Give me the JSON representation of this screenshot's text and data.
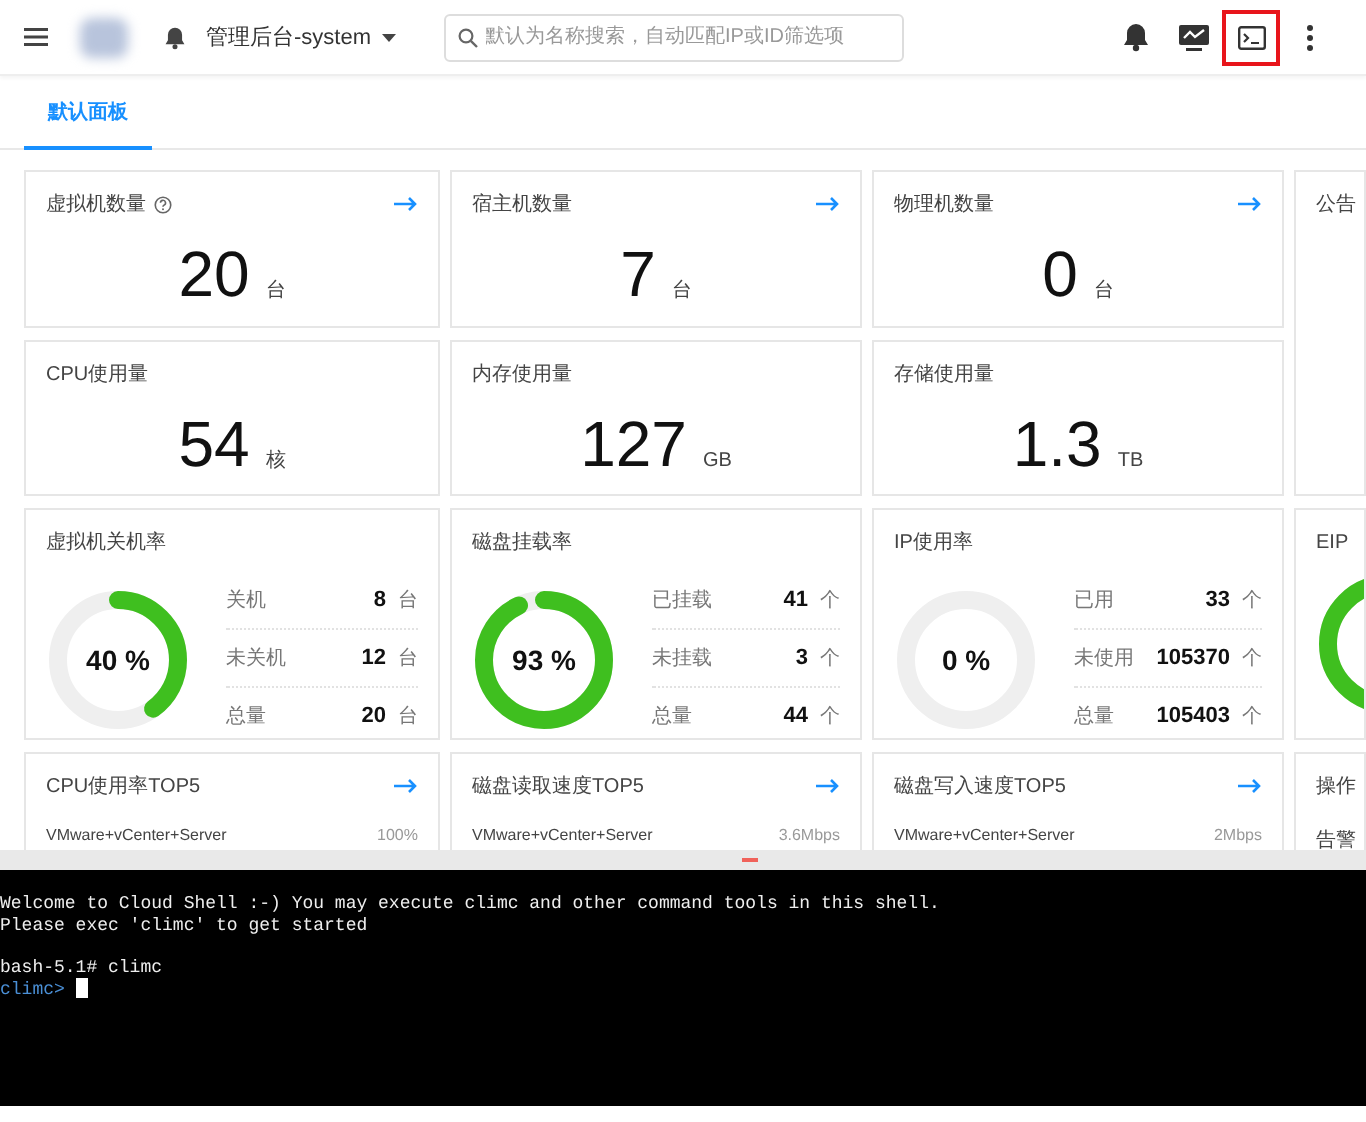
{
  "topbar": {
    "project": "管理后台-system",
    "search": {
      "placeholder": "默认为名称搜索，自动匹配IP或ID筛选项"
    },
    "actions": [
      {
        "kind": "bell",
        "highlighted": false
      },
      {
        "kind": "monitor",
        "highlighted": false
      },
      {
        "kind": "terminal",
        "highlighted": true
      },
      {
        "kind": "more",
        "highlighted": false
      }
    ]
  },
  "tabs": [
    {
      "label": "默认面板",
      "selected": true
    }
  ],
  "cards": [
    {
      "kind": "stat",
      "title": "虚拟机数量",
      "help": true,
      "link": true,
      "value": "20",
      "unit": "台"
    },
    {
      "kind": "stat",
      "title": "宿主机数量",
      "help": false,
      "link": true,
      "value": "7",
      "unit": "台"
    },
    {
      "kind": "stat",
      "title": "物理机数量",
      "help": false,
      "link": true,
      "value": "0",
      "unit": "台"
    },
    {
      "kind": "notice",
      "title": "公告"
    },
    {
      "kind": "stat",
      "title": "CPU使用量",
      "help": false,
      "link": false,
      "value": "54",
      "unit": "核"
    },
    {
      "kind": "stat",
      "title": "内存使用量",
      "help": false,
      "link": false,
      "value": "127",
      "unit": "GB"
    },
    {
      "kind": "stat",
      "title": "存储使用量",
      "help": false,
      "link": false,
      "value": "1.3",
      "unit": "TB"
    },
    {
      "kind": "donut",
      "title": "虚拟机关机率",
      "level": 0.4,
      "percent": "40 %",
      "rows": [
        {
          "label": "关机",
          "value": "8",
          "unit": "台"
        },
        {
          "label": "未关机",
          "value": "12",
          "unit": "台"
        },
        {
          "label": "总量",
          "value": "20",
          "unit": "台"
        }
      ]
    },
    {
      "kind": "donut",
      "title": "磁盘挂载率",
      "level": 0.93,
      "percent": "93 %",
      "rows": [
        {
          "label": "已挂载",
          "value": "41",
          "unit": "个"
        },
        {
          "label": "未挂载",
          "value": "3",
          "unit": "个"
        },
        {
          "label": "总量",
          "value": "44",
          "unit": "个"
        }
      ]
    },
    {
      "kind": "donut",
      "title": "IP使用率",
      "percent": "0 %",
      "rows": [
        {
          "label": "已用",
          "value": "33",
          "unit": "个"
        },
        {
          "label": "未使用",
          "value": "105370",
          "unit": "个"
        },
        {
          "label": "总量",
          "value": "105403",
          "unit": "个"
        }
      ]
    },
    {
      "kind": "donut",
      "title": "EIP"
    },
    {
      "kind": "top",
      "title": "CPU使用率TOP5",
      "link": true,
      "items": [
        {
          "name": "VMware+vCenter+Server",
          "value": "100%"
        }
      ]
    },
    {
      "kind": "top",
      "title": "磁盘读取速度TOP5",
      "link": true,
      "items": [
        {
          "name": "VMware+vCenter+Server",
          "value": "3.6Mbps"
        }
      ]
    },
    {
      "kind": "top",
      "title": "磁盘写入速度TOP5",
      "link": true,
      "items": [
        {
          "name": "VMware+vCenter+Server",
          "value": "2Mbps"
        }
      ]
    },
    {
      "kind": "top",
      "title": "操作",
      "items": [
        {
          "name": "告警"
        }
      ]
    }
  ],
  "shell": {
    "lines": [
      {
        "kind": "output",
        "text": "Welcome to Cloud Shell :-) You may execute climc and other command tools in this shell."
      },
      {
        "kind": "output",
        "text": "Please exec 'climc' to get started"
      },
      {
        "kind": "command",
        "text": "bash-5.1# climc"
      },
      {
        "kind": "prompt",
        "text": "climc>",
        "cursor": true
      }
    ]
  }
}
